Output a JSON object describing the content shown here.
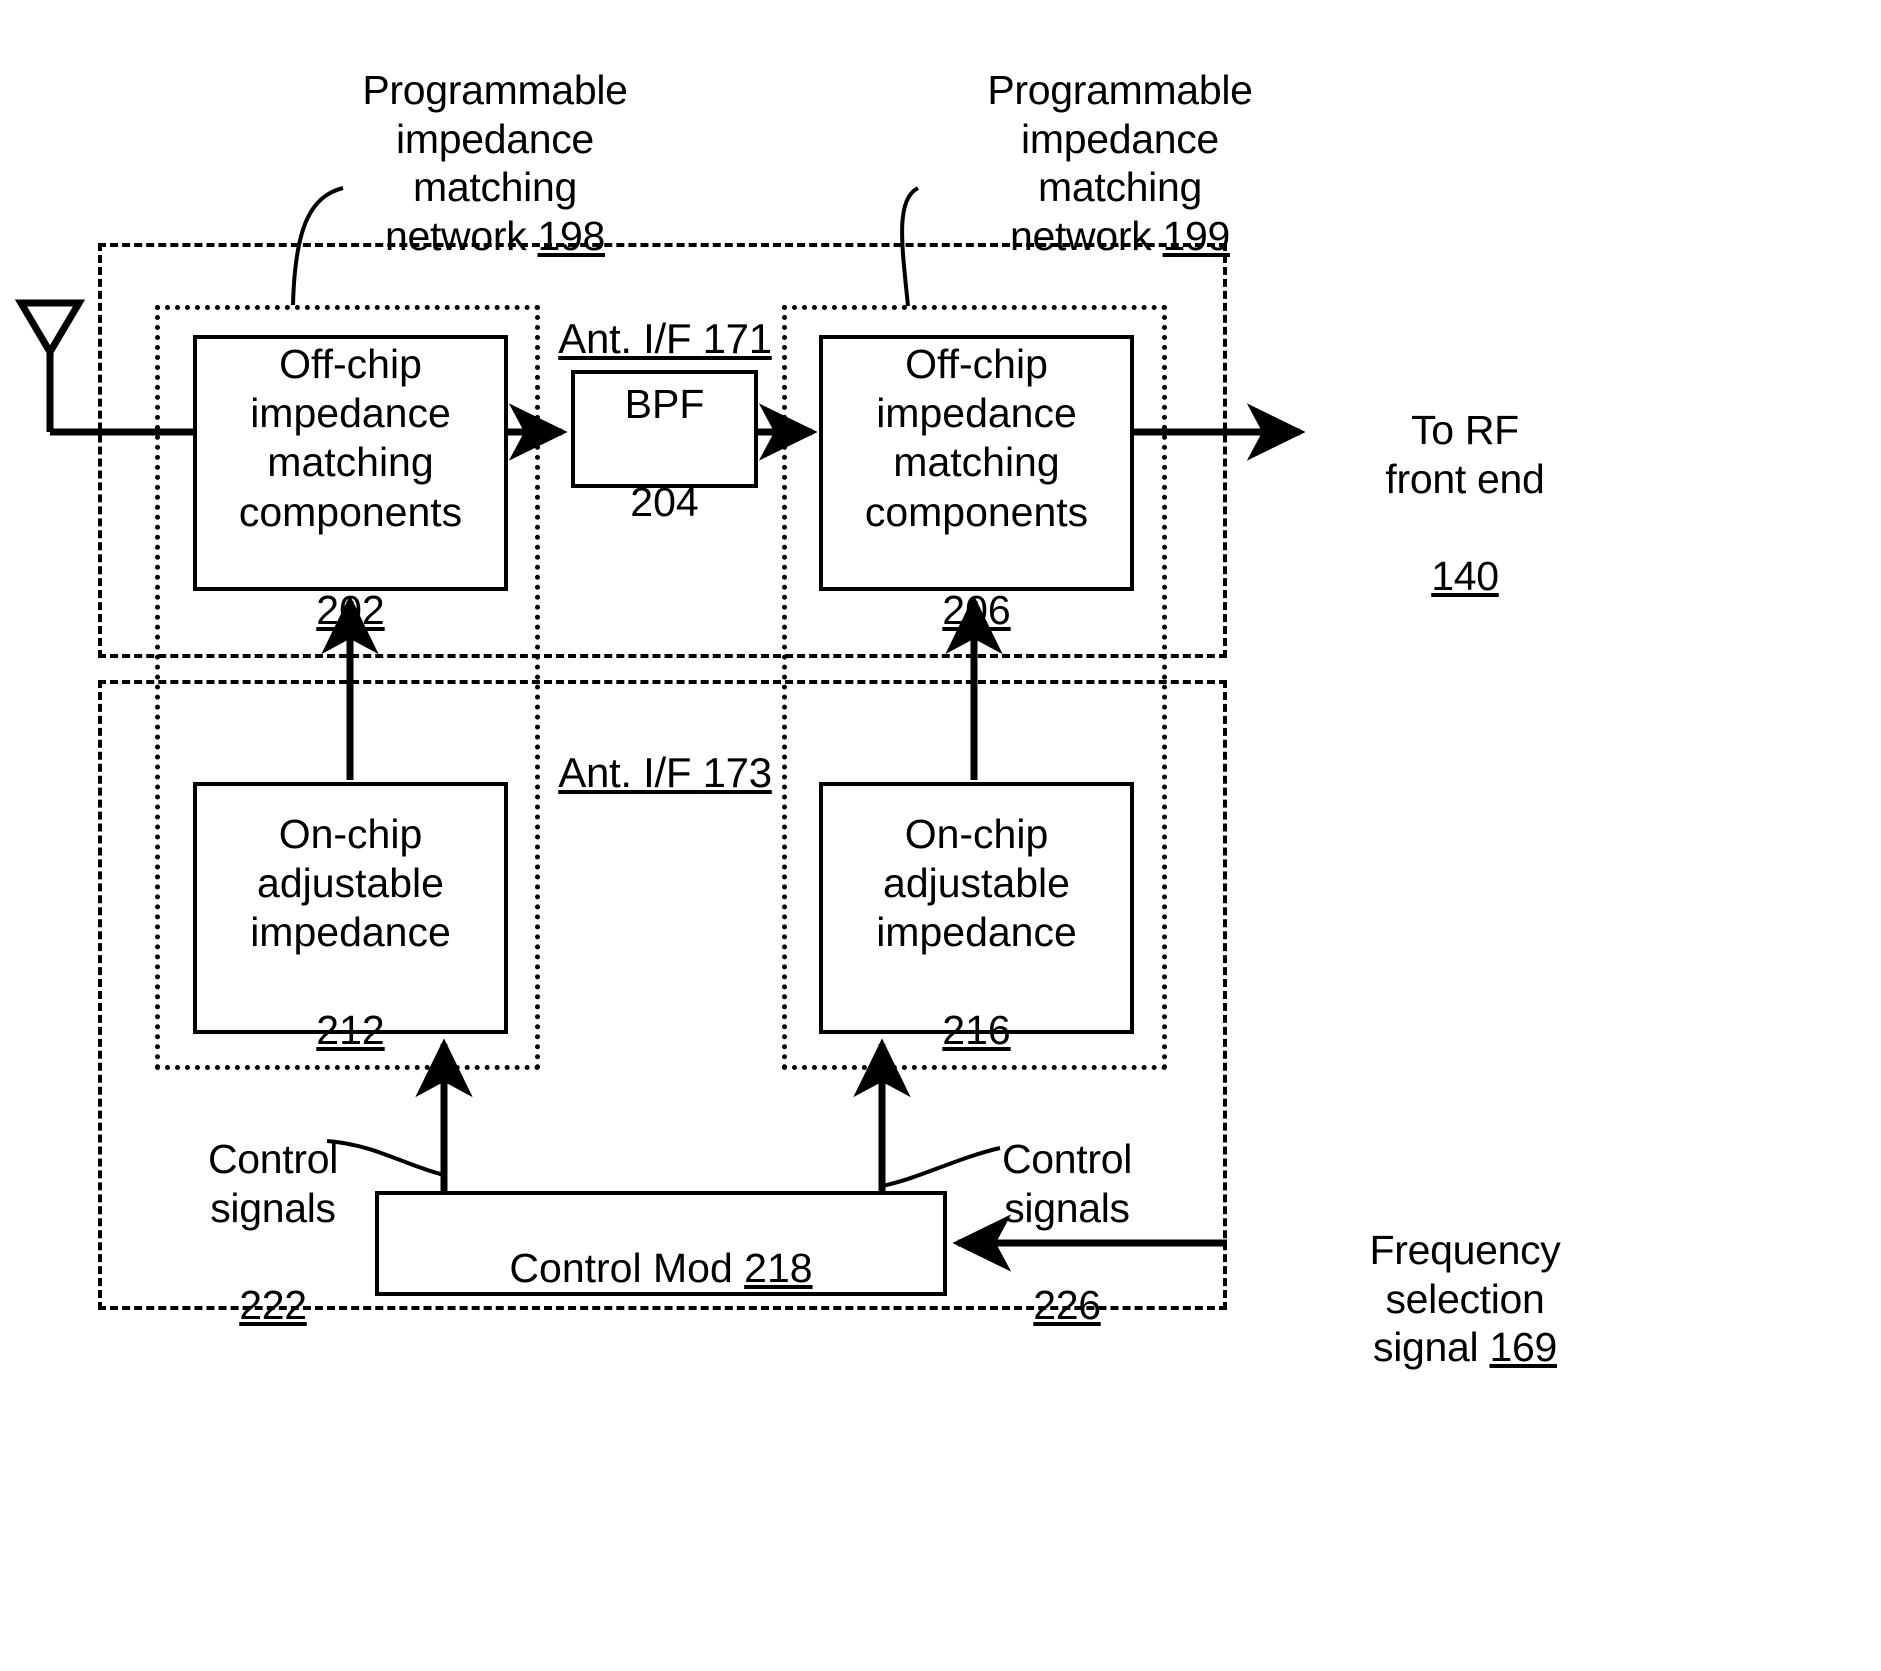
{
  "figure": {
    "title_labels": {
      "pimn_left": "Programmable\nimpedance\nmatching\nnetwork ",
      "pimn_left_num": "198",
      "pimn_right": "Programmable\nimpedance\nmatching\nnetwork ",
      "pimn_right_num": "199"
    },
    "regions": [
      {
        "name": "ant-if-171",
        "label_prefix": "Ant. I/F ",
        "label_num": "171"
      },
      {
        "name": "ant-if-173",
        "label_prefix": "Ant. I/F ",
        "label_num": "173"
      }
    ],
    "blocks": [
      {
        "name": "off-chip-impedance-matching-components-202",
        "text": "Off-chip\nimpedance\nmatching\ncomponents",
        "ref": "202"
      },
      {
        "name": "bpf-204",
        "text": "BPF",
        "ref": "204"
      },
      {
        "name": "off-chip-impedance-matching-components-206",
        "text": "Off-chip\nimpedance\nmatching\ncomponents",
        "ref": "206"
      },
      {
        "name": "on-chip-adjustable-impedance-212",
        "text": "On-chip\nadjustable\nimpedance",
        "ref": "212"
      },
      {
        "name": "on-chip-adjustable-impedance-216",
        "text": "On-chip\nadjustable\nimpedance",
        "ref": "216"
      },
      {
        "name": "control-mod-218",
        "text": "Control Mod ",
        "ref": "218"
      }
    ],
    "annotations": {
      "to_rf_front_end": "To RF\nfront end",
      "to_rf_front_end_num": "140",
      "control_signals_left": "Control\nsignals",
      "control_signals_left_num": "222",
      "control_signals_right": "Control\nsignals",
      "control_signals_right_num": "226",
      "frequency_selection": "Frequency\nselection\nsignal ",
      "frequency_selection_num": "169"
    },
    "colors": {
      "stroke": "#000000",
      "background": "#ffffff"
    }
  }
}
